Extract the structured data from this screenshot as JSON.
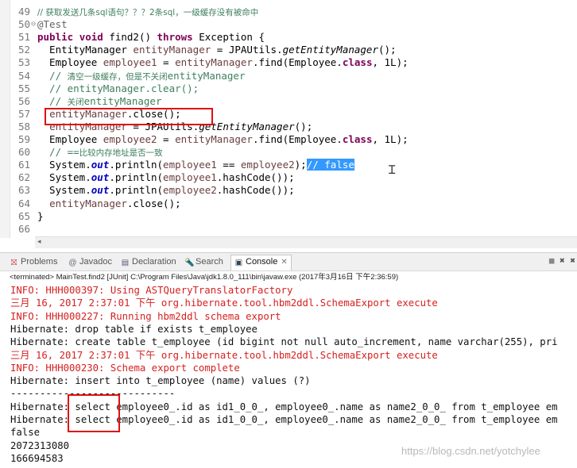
{
  "editor": {
    "lines": [
      {
        "num": "49",
        "parts": [
          [
            "cmz",
            "// 获取发送几条sql语句？？？2条sql，一级缓存没有被命中"
          ]
        ]
      },
      {
        "num": "50",
        "fold": "⊖",
        "parts": [
          [
            "ann",
            "@Test"
          ]
        ]
      },
      {
        "num": "51",
        "parts": [
          [
            "kw",
            "public"
          ],
          [
            "t",
            " "
          ],
          [
            "kw",
            "void"
          ],
          [
            "t",
            " find2() "
          ],
          [
            "kw",
            "throws"
          ],
          [
            "t",
            " Exception {"
          ]
        ]
      },
      {
        "num": "52",
        "parts": [
          [
            "t",
            "  EntityManager "
          ],
          [
            "var",
            "entityManager"
          ],
          [
            "t",
            " = JPAUtils."
          ],
          [
            "it",
            "getEntityManager"
          ],
          [
            "t",
            "();"
          ]
        ]
      },
      {
        "num": "53",
        "parts": [
          [
            "t",
            "  Employee "
          ],
          [
            "var",
            "employee1"
          ],
          [
            "t",
            " = "
          ],
          [
            "var",
            "entityManager"
          ],
          [
            "t",
            ".find(Employee."
          ],
          [
            "kw",
            "class"
          ],
          [
            "t",
            ", 1L);"
          ]
        ]
      },
      {
        "num": "54",
        "parts": [
          [
            "cm",
            "  // "
          ],
          [
            "cmz",
            "清空一级缓存，但是不关闭"
          ],
          [
            "cm",
            "entityManager"
          ]
        ]
      },
      {
        "num": "55",
        "parts": [
          [
            "cm",
            "  // entityManager.clear();"
          ]
        ]
      },
      {
        "num": "56",
        "parts": [
          [
            "cm",
            "  // "
          ],
          [
            "cmz",
            "关闭"
          ],
          [
            "cm",
            "entityManager"
          ]
        ]
      },
      {
        "num": "57",
        "parts": [
          [
            "t",
            "  "
          ],
          [
            "var",
            "entityManager"
          ],
          [
            "t",
            ".close();"
          ]
        ]
      },
      {
        "num": "58",
        "parts": [
          [
            "t",
            "  "
          ],
          [
            "var",
            "entityManager"
          ],
          [
            "t",
            " = JPAUtils."
          ],
          [
            "it",
            "getEntityManager"
          ],
          [
            "t",
            "();"
          ]
        ]
      },
      {
        "num": "59",
        "parts": [
          [
            "t",
            "  Employee "
          ],
          [
            "var",
            "employee2"
          ],
          [
            "t",
            " = "
          ],
          [
            "var",
            "entityManager"
          ],
          [
            "t",
            ".find(Employee."
          ],
          [
            "kw",
            "class"
          ],
          [
            "t",
            ", 1L);"
          ]
        ]
      },
      {
        "num": "60",
        "parts": [
          [
            "cm",
            "  // =="
          ],
          [
            "cmz",
            "比较内存地址是否一致"
          ]
        ]
      },
      {
        "num": "61",
        "parts": [
          [
            "t",
            "  System."
          ],
          [
            "fld",
            "out"
          ],
          [
            "t",
            ".println("
          ],
          [
            "var",
            "employee1"
          ],
          [
            "t",
            " == "
          ],
          [
            "var",
            "employee2"
          ],
          [
            "t",
            ");"
          ],
          [
            "sel",
            "// false"
          ]
        ]
      },
      {
        "num": "62",
        "parts": [
          [
            "t",
            "  System."
          ],
          [
            "fld",
            "out"
          ],
          [
            "t",
            ".println("
          ],
          [
            "var",
            "employee1"
          ],
          [
            "t",
            ".hashCode());"
          ]
        ]
      },
      {
        "num": "63",
        "parts": [
          [
            "t",
            "  System."
          ],
          [
            "fld",
            "out"
          ],
          [
            "t",
            ".println("
          ],
          [
            "var",
            "employee2"
          ],
          [
            "t",
            ".hashCode());"
          ]
        ]
      },
      {
        "num": "64",
        "parts": [
          [
            "t",
            "  "
          ],
          [
            "var",
            "entityManager"
          ],
          [
            "t",
            ".close();"
          ]
        ]
      },
      {
        "num": "65",
        "parts": [
          [
            "t",
            "}"
          ]
        ]
      },
      {
        "num": "66",
        "parts": []
      }
    ]
  },
  "views": {
    "problems": "Problems",
    "javadoc": "Javadoc",
    "declaration": "Declaration",
    "search": "Search",
    "console": "Console"
  },
  "console": {
    "terminated": "<terminated> MainTest.find2 [JUnit] C:\\Program Files\\Java\\jdk1.8.0_111\\bin\\javaw.exe (2017年3月16日 下午2:36:59)",
    "lines": [
      {
        "c": "red",
        "t": "INFO: HHH000397: Using ASTQueryTranslatorFactory"
      },
      {
        "c": "red",
        "t": "三月 16, 2017 2:37:01 下午 org.hibernate.tool.hbm2ddl.SchemaExport execute"
      },
      {
        "c": "red",
        "t": "INFO: HHH000227: Running hbm2ddl schema export"
      },
      {
        "c": "blk",
        "t": "Hibernate: drop table if exists t_employee"
      },
      {
        "c": "blk",
        "t": "Hibernate: create table t_employee (id bigint not null auto_increment, name varchar(255), pri"
      },
      {
        "c": "red",
        "t": "三月 16, 2017 2:37:01 下午 org.hibernate.tool.hbm2ddl.SchemaExport execute"
      },
      {
        "c": "red",
        "t": "INFO: HHH000230: Schema export complete"
      },
      {
        "c": "blk",
        "t": "Hibernate: insert into t_employee (name) values (?)"
      },
      {
        "c": "blk",
        "t": "----------------------------"
      },
      {
        "c": "blk",
        "t": "Hibernate: select employee0_.id as id1_0_0_, employee0_.name as name2_0_0_ from t_employee em"
      },
      {
        "c": "blk",
        "t": "Hibernate: select employee0_.id as id1_0_0_, employee0_.name as name2_0_0_ from t_employee em"
      },
      {
        "c": "blk",
        "t": "false"
      },
      {
        "c": "blk",
        "t": "2072313080"
      },
      {
        "c": "blk",
        "t": "166694583"
      }
    ]
  },
  "watermark": "https://blog.csdn.net/yotchylee",
  "colors": {
    "highlight_box": "#e01010",
    "error_text": "#d62020",
    "selection": "#3399ff"
  }
}
